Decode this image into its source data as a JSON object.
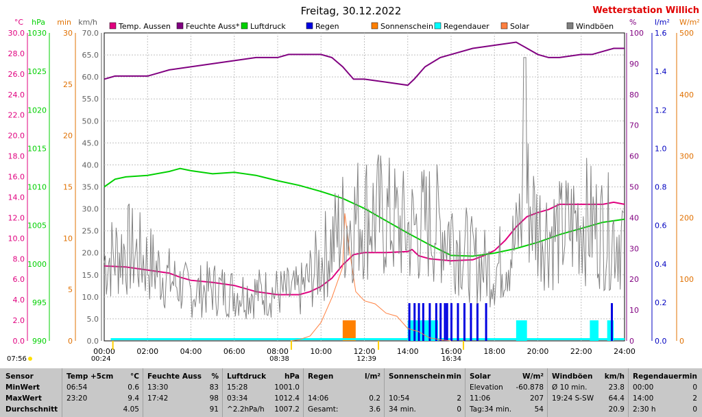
{
  "title": "Freitag, 30.12.2022",
  "station": "Wetterstation Willich",
  "axes_left": [
    {
      "unit": "°C",
      "color": "#e0007f",
      "ticks": [
        "30.0",
        "28.0",
        "26.0",
        "24.0",
        "22.0",
        "20.0",
        "18.0",
        "16.0",
        "14.0",
        "12.0",
        "10.0",
        "8.0",
        "6.0",
        "4.0",
        "2.0",
        "0.0"
      ]
    },
    {
      "unit": "hPa",
      "color": "#00d000",
      "ticks": [
        "1030",
        "1025",
        "1020",
        "1015",
        "1010",
        "1005",
        "1000",
        "995",
        "990"
      ]
    },
    {
      "unit": "min",
      "color": "#e07000",
      "ticks": [
        "30",
        "25",
        "20",
        "15",
        "10",
        "5",
        "0"
      ]
    },
    {
      "unit": "km/h",
      "color": "#606060",
      "ticks": [
        "70.0",
        "65.0",
        "60.0",
        "55.0",
        "50.0",
        "45.0",
        "40.0",
        "35.0",
        "30.0",
        "25.0",
        "20.0",
        "15.0",
        "10.0",
        "5.0",
        "0.0"
      ]
    }
  ],
  "axes_right": [
    {
      "unit": "%",
      "color": "#800080",
      "ticks": [
        "100",
        "90",
        "80",
        "70",
        "60",
        "50",
        "40",
        "30",
        "20",
        "10",
        "0"
      ]
    },
    {
      "unit": "l/m²",
      "color": "#0000c0",
      "ticks": [
        "1.6",
        "1.4",
        "1.2",
        "1.0",
        "0.8",
        "0.6",
        "0.4",
        "0.2",
        "0.0"
      ]
    },
    {
      "unit": "W/m²",
      "color": "#e07000",
      "ticks": [
        "500",
        "400",
        "300",
        "200",
        "100",
        "0"
      ]
    }
  ],
  "legend": [
    {
      "label": "Temp. Aussen",
      "color": "#e0007f"
    },
    {
      "label": "Feuchte Auss*",
      "color": "#800080"
    },
    {
      "label": "Luftdruck",
      "color": "#00d000"
    },
    {
      "label": "Regen",
      "color": "#0000e0"
    },
    {
      "label": "Sonnenschein",
      "color": "#ff8000"
    },
    {
      "label": "Regendauer",
      "color": "#00ffff"
    },
    {
      "label": "Solar",
      "color": "#ff8040"
    },
    {
      "label": "Windböen",
      "color": "#808080"
    }
  ],
  "time_markers": [
    {
      "label": "07:56",
      "t": 7.93
    },
    {
      "label": "00:24",
      "t": 0.4
    },
    {
      "label": "08:38",
      "t": 8.63
    },
    {
      "label": "12:39",
      "t": 12.65
    },
    {
      "label": "16:34",
      "t": 16.57
    }
  ],
  "chart_data": {
    "type": "line",
    "x_range": [
      "00:00",
      "24:00"
    ],
    "x_ticks": [
      "00:00",
      "02:00",
      "04:00",
      "06:00",
      "08:00",
      "10:00",
      "12:00",
      "14:00",
      "16:00",
      "18:00",
      "20:00",
      "22:00",
      "24:00"
    ],
    "series": [
      {
        "name": "Temp. Aussen",
        "unit": "°C",
        "points": [
          [
            0,
            7.3
          ],
          [
            1,
            7.2
          ],
          [
            2,
            6.9
          ],
          [
            3,
            6.6
          ],
          [
            3.5,
            6.2
          ],
          [
            4,
            5.9
          ],
          [
            5,
            5.7
          ],
          [
            6,
            5.4
          ],
          [
            7,
            4.8
          ],
          [
            8,
            4.5
          ],
          [
            8.5,
            4.5
          ],
          [
            9,
            4.5
          ],
          [
            9.5,
            4.8
          ],
          [
            10,
            5.3
          ],
          [
            10.5,
            6.1
          ],
          [
            11,
            7.4
          ],
          [
            11.5,
            8.4
          ],
          [
            12,
            8.6
          ],
          [
            13,
            8.6
          ],
          [
            14,
            8.7
          ],
          [
            14.2,
            8.9
          ],
          [
            14.5,
            8.3
          ],
          [
            15,
            8.0
          ],
          [
            16,
            7.8
          ],
          [
            17,
            7.9
          ],
          [
            17.5,
            8.3
          ],
          [
            18,
            8.8
          ],
          [
            18.5,
            9.8
          ],
          [
            19,
            11.1
          ],
          [
            19.5,
            12.1
          ],
          [
            20,
            12.5
          ],
          [
            20.5,
            12.8
          ],
          [
            21,
            13.3
          ],
          [
            22,
            13.3
          ],
          [
            23,
            13.3
          ],
          [
            23.5,
            13.5
          ],
          [
            24,
            13.3
          ]
        ]
      },
      {
        "name": "Feuchte Auss*",
        "unit": "%",
        "points": [
          [
            0,
            85
          ],
          [
            0.5,
            86
          ],
          [
            2,
            86
          ],
          [
            2.5,
            87
          ],
          [
            3,
            88
          ],
          [
            4,
            89
          ],
          [
            5,
            90
          ],
          [
            6,
            91
          ],
          [
            7,
            92
          ],
          [
            8,
            92
          ],
          [
            8.5,
            93
          ],
          [
            9,
            93
          ],
          [
            10,
            93
          ],
          [
            10.5,
            92
          ],
          [
            11,
            89
          ],
          [
            11.5,
            85
          ],
          [
            12,
            85
          ],
          [
            13,
            84
          ],
          [
            14,
            83
          ],
          [
            14.3,
            85
          ],
          [
            14.8,
            89
          ],
          [
            15.5,
            92
          ],
          [
            16,
            93
          ],
          [
            17,
            95
          ],
          [
            18,
            96
          ],
          [
            19,
            97
          ],
          [
            20,
            93
          ],
          [
            20.5,
            92
          ],
          [
            21,
            92
          ],
          [
            22,
            93
          ],
          [
            22.5,
            93
          ],
          [
            23,
            94
          ],
          [
            23.5,
            95
          ],
          [
            24,
            95
          ]
        ]
      },
      {
        "name": "Luftdruck",
        "unit": "hPa",
        "points": [
          [
            0,
            1010
          ],
          [
            0.5,
            1011
          ],
          [
            1,
            1011.3
          ],
          [
            2,
            1011.5
          ],
          [
            3,
            1012
          ],
          [
            3.5,
            1012.4
          ],
          [
            4,
            1012.1
          ],
          [
            5,
            1011.7
          ],
          [
            6,
            1011.9
          ],
          [
            7,
            1011.5
          ],
          [
            8,
            1010.8
          ],
          [
            9,
            1010.2
          ],
          [
            10,
            1009.4
          ],
          [
            11,
            1008.5
          ],
          [
            12,
            1007.2
          ],
          [
            13,
            1005.6
          ],
          [
            14,
            1004
          ],
          [
            15,
            1002.5
          ],
          [
            16,
            1001.1
          ],
          [
            17,
            1001
          ],
          [
            18,
            1001.4
          ],
          [
            19,
            1002
          ],
          [
            20,
            1002.8
          ],
          [
            21,
            1003.8
          ],
          [
            22,
            1004.6
          ],
          [
            23,
            1005.4
          ],
          [
            24,
            1005.8
          ]
        ]
      },
      {
        "name": "Solar",
        "unit": "W/m²",
        "points": [
          [
            8.6,
            0
          ],
          [
            9,
            2
          ],
          [
            9.5,
            8
          ],
          [
            10,
            30
          ],
          [
            10.5,
            70
          ],
          [
            11,
            120
          ],
          [
            11.1,
            207
          ],
          [
            11.3,
            150
          ],
          [
            11.6,
            80
          ],
          [
            12,
            65
          ],
          [
            12.5,
            60
          ],
          [
            13,
            45
          ],
          [
            13.5,
            40
          ],
          [
            14,
            20
          ],
          [
            14.5,
            15
          ],
          [
            15,
            5
          ],
          [
            15.5,
            2
          ],
          [
            16,
            0
          ]
        ]
      },
      {
        "name": "Windböen",
        "unit": "km/h",
        "type": "noisy",
        "points": [
          [
            0,
            18
          ],
          [
            1,
            21
          ],
          [
            2,
            18
          ],
          [
            3,
            14
          ],
          [
            4,
            11
          ],
          [
            5,
            12
          ],
          [
            6,
            11
          ],
          [
            7,
            11
          ],
          [
            8,
            11
          ],
          [
            9,
            11
          ],
          [
            10,
            18
          ],
          [
            11,
            26
          ],
          [
            12,
            29
          ],
          [
            13,
            28
          ],
          [
            14,
            25
          ],
          [
            15,
            27
          ],
          [
            16,
            25
          ],
          [
            17,
            18
          ],
          [
            18,
            16
          ],
          [
            19,
            22
          ],
          [
            19.4,
            34
          ],
          [
            20,
            26
          ],
          [
            21,
            24
          ],
          [
            22,
            28
          ],
          [
            23,
            25
          ],
          [
            24,
            24
          ]
        ]
      }
    ],
    "bars": [
      {
        "name": "Sonnenschein",
        "unit": "min",
        "x": 11,
        "width_h": 0.6,
        "value": 2
      },
      {
        "name": "Regendauer",
        "unit": "min",
        "segments": [
          [
            14.0,
            15.4,
            2
          ],
          [
            19.0,
            19.5,
            2
          ],
          [
            22.4,
            22.8,
            2
          ],
          [
            23.2,
            23.5,
            2
          ]
        ]
      },
      {
        "name": "Regen",
        "unit": "l/m²",
        "ticks": [
          14.06,
          14.3,
          14.5,
          14.7,
          15.0,
          15.3,
          15.5,
          15.7,
          15.8,
          16.0,
          16.3,
          16.6,
          16.9,
          17.2,
          17.6,
          23.4
        ]
      }
    ]
  },
  "stats": {
    "columns": [
      {
        "head": [
          "Sensor",
          ""
        ],
        "rows": [
          [
            "MinWert",
            ""
          ],
          [
            "MaxWert",
            ""
          ],
          [
            "Durchschnitt",
            ""
          ]
        ]
      },
      {
        "head": [
          "Temp +5cm",
          "°C"
        ],
        "rows": [
          [
            "06:54",
            "0.6"
          ],
          [
            "23:20",
            "9.4"
          ],
          [
            "",
            "4.05"
          ]
        ]
      },
      {
        "head": [
          "Feuchte Auss",
          "%"
        ],
        "rows": [
          [
            "13:30",
            "83"
          ],
          [
            "17:42",
            "98"
          ],
          [
            "",
            "91"
          ]
        ]
      },
      {
        "head": [
          "Luftdruck",
          "hPa"
        ],
        "rows": [
          [
            "15:28",
            "1001.0"
          ],
          [
            "03:34",
            "1012.4"
          ],
          [
            "^2.2hPa/h",
            "1007.2"
          ]
        ]
      },
      {
        "head": [
          "Regen",
          "l/m²"
        ],
        "rows": [
          [
            "",
            ""
          ],
          [
            "14:06",
            "0.2"
          ],
          [
            "Gesamt:",
            "3.6"
          ]
        ]
      },
      {
        "head": [
          "Sonnenschein",
          "min"
        ],
        "rows": [
          [
            "",
            ""
          ],
          [
            "10:54",
            "2"
          ],
          [
            "34 min.",
            "0"
          ]
        ]
      },
      {
        "head": [
          "Solar",
          "W/m²"
        ],
        "rows": [
          [
            "Elevation",
            "-60.878"
          ],
          [
            "11:06",
            "207"
          ],
          [
            "Tag:34 min.",
            "54"
          ]
        ]
      },
      {
        "head": [
          "Windböen",
          "km/h"
        ],
        "rows": [
          [
            "Ø 10 min.",
            "23.8"
          ],
          [
            "19:24  S-SW",
            "64.4"
          ],
          [
            "",
            "20.9"
          ]
        ]
      },
      {
        "head": [
          "Regendauer",
          "min"
        ],
        "rows": [
          [
            "00:00",
            "0"
          ],
          [
            "14:00",
            "2"
          ],
          [
            "2:30 h",
            "0"
          ]
        ]
      }
    ]
  }
}
